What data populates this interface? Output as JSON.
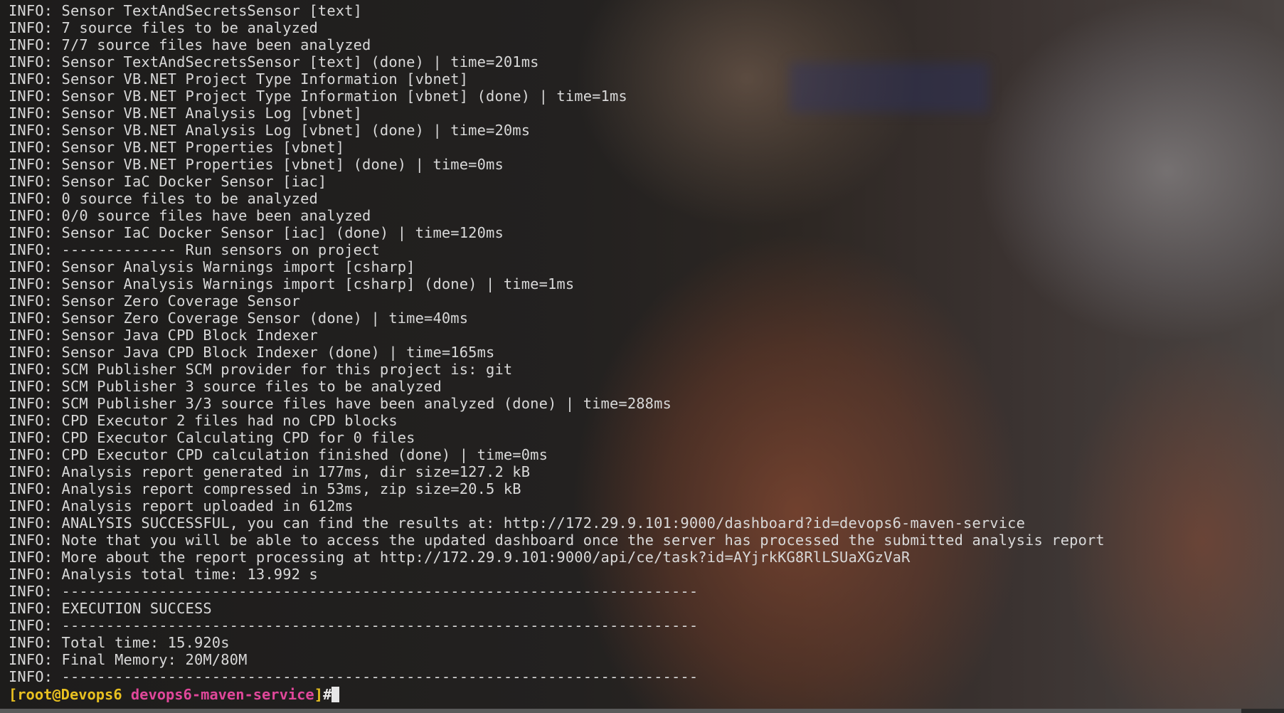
{
  "terminal": {
    "lines": [
      "INFO: Sensor TextAndSecretsSensor [text]",
      "INFO: 7 source files to be analyzed",
      "INFO: 7/7 source files have been analyzed",
      "INFO: Sensor TextAndSecretsSensor [text] (done) | time=201ms",
      "INFO: Sensor VB.NET Project Type Information [vbnet]",
      "INFO: Sensor VB.NET Project Type Information [vbnet] (done) | time=1ms",
      "INFO: Sensor VB.NET Analysis Log [vbnet]",
      "INFO: Sensor VB.NET Analysis Log [vbnet] (done) | time=20ms",
      "INFO: Sensor VB.NET Properties [vbnet]",
      "INFO: Sensor VB.NET Properties [vbnet] (done) | time=0ms",
      "INFO: Sensor IaC Docker Sensor [iac]",
      "INFO: 0 source files to be analyzed",
      "INFO: 0/0 source files have been analyzed",
      "INFO: Sensor IaC Docker Sensor [iac] (done) | time=120ms",
      "INFO: ------------- Run sensors on project",
      "INFO: Sensor Analysis Warnings import [csharp]",
      "INFO: Sensor Analysis Warnings import [csharp] (done) | time=1ms",
      "INFO: Sensor Zero Coverage Sensor",
      "INFO: Sensor Zero Coverage Sensor (done) | time=40ms",
      "INFO: Sensor Java CPD Block Indexer",
      "INFO: Sensor Java CPD Block Indexer (done) | time=165ms",
      "INFO: SCM Publisher SCM provider for this project is: git",
      "INFO: SCM Publisher 3 source files to be analyzed",
      "INFO: SCM Publisher 3/3 source files have been analyzed (done) | time=288ms",
      "INFO: CPD Executor 2 files had no CPD blocks",
      "INFO: CPD Executor Calculating CPD for 0 files",
      "INFO: CPD Executor CPD calculation finished (done) | time=0ms",
      "INFO: Analysis report generated in 177ms, dir size=127.2 kB",
      "INFO: Analysis report compressed in 53ms, zip size=20.5 kB",
      "INFO: Analysis report uploaded in 612ms",
      "INFO: ANALYSIS SUCCESSFUL, you can find the results at: http://172.29.9.101:9000/dashboard?id=devops6-maven-service",
      "INFO: Note that you will be able to access the updated dashboard once the server has processed the submitted analysis report",
      "INFO: More about the report processing at http://172.29.9.101:9000/api/ce/task?id=AYjrkKG8RlLSUaXGzVaR",
      "INFO: Analysis total time: 13.992 s",
      "INFO: ------------------------------------------------------------------------",
      "INFO: EXECUTION SUCCESS",
      "INFO: ------------------------------------------------------------------------",
      "INFO: Total time: 15.920s",
      "INFO: Final Memory: 20M/80M",
      "INFO: ------------------------------------------------------------------------"
    ],
    "prompt": {
      "open_bracket": "[",
      "user": "root",
      "at": "@",
      "host": "Devops6",
      "space": " ",
      "path": "devops6-maven-service",
      "close_bracket": "]",
      "symbol": "#"
    }
  },
  "colors": {
    "output_text": "#d8d8d8",
    "prompt_user_host": "#e8c020",
    "prompt_path": "#e0479a",
    "cursor": "#e6e6e6"
  }
}
